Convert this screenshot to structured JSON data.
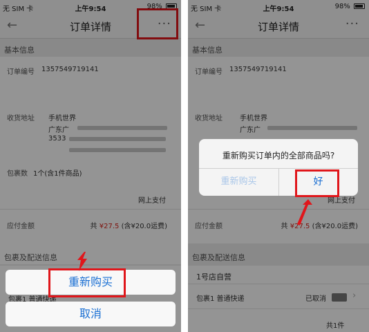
{
  "left": {
    "status": {
      "carrier": "无 SIM 卡",
      "time": "上午9:54",
      "battery": "98%"
    },
    "nav": {
      "back_icon": "←",
      "title": "订单详情",
      "more_icon": "···"
    },
    "section_basic": "基本信息",
    "order_no_label": "订单编号",
    "order_no": "1357549719141",
    "addr_label": "收货地址",
    "addr_line1": "手机世界",
    "addr_line2": "广东广",
    "addr_line3": "3533",
    "pkg_count_label": "包裹数",
    "pkg_count": "1个(含1件商品)",
    "payment": "网上支付",
    "amount_label": "应付金额",
    "amount_prefix": "共",
    "amount": "¥27.5",
    "amount_note": "(含¥20.0运费)",
    "section_pkg": "包裹及配送信息",
    "pkg_row": "包裹1 普通快递",
    "sheet": {
      "rebuy": "重新购买",
      "cancel": "取消"
    }
  },
  "right": {
    "status": {
      "carrier": "无 SIM 卡",
      "time": "上午9:54",
      "battery": "98%"
    },
    "nav": {
      "back_icon": "←",
      "title": "订单详情",
      "more_icon": "···"
    },
    "section_basic": "基本信息",
    "order_no_label": "订单编号",
    "order_no": "1357549719141",
    "addr_label": "收货地址",
    "addr_line1": "手机世界",
    "addr_line2": "广东广",
    "payment": "网上支付",
    "amount_label": "应付金额",
    "amount_prefix": "共",
    "amount": "¥27.5",
    "amount_note": "(含¥20.0运费)",
    "section_pkg": "包裹及配送信息",
    "store": "1号店自营",
    "pkg_row": "包裹1 普通快递",
    "pkg_status": "已取消",
    "item_count": "共1件",
    "alert": {
      "message": "重新购买订单内的全部商品吗?",
      "cancel": "重新购买",
      "ok": "好"
    }
  },
  "colors": {
    "highlight": "#e0161b",
    "link_blue": "#1a6fd3",
    "price_red": "#d9251c"
  }
}
